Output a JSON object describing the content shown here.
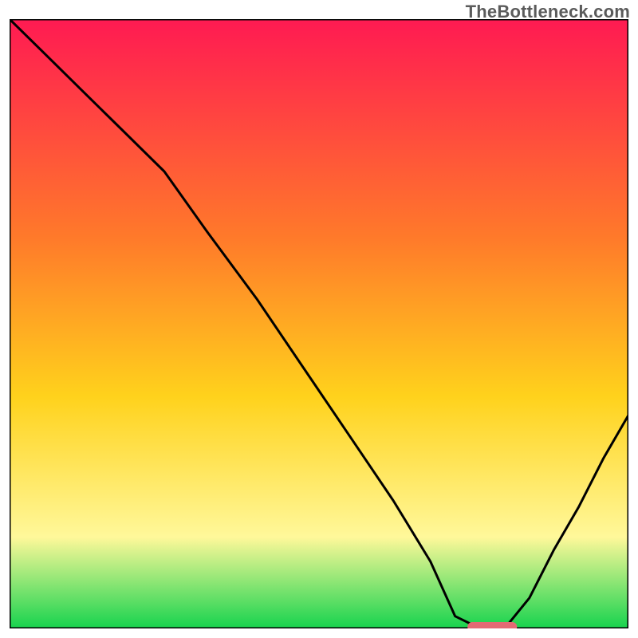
{
  "watermark": "TheBottleneck.com",
  "chart_data": {
    "type": "line",
    "title": "",
    "xlabel": "",
    "ylabel": "",
    "xlim": [
      0,
      100
    ],
    "ylim": [
      0,
      100
    ],
    "grid": false,
    "legend": false,
    "annotations": [],
    "background_gradient": {
      "top": "#ff1a52",
      "mid1": "#ff7a2a",
      "mid2": "#ffd21c",
      "mid3": "#fff89a",
      "bottom": "#17d34e"
    },
    "curve_note": "Single black V-shaped curve: starts at top-left (x≈0,y≈100), descends nearly linearly with a slope change around x≈25 y≈75, reaches a flat minimum near x≈72–80 at y≈0, then rises toward x=100 y≈35. A short red-pink rounded bar sits on the x-axis at the curve minimum.",
    "series": [
      {
        "name": "curve",
        "x": [
          0,
          6,
          12,
          18,
          25,
          32,
          40,
          48,
          56,
          62,
          68,
          72,
          76,
          80,
          84,
          88,
          92,
          96,
          100
        ],
        "y": [
          100,
          94,
          88,
          82,
          75,
          65,
          54,
          42,
          30,
          21,
          11,
          2,
          0,
          0,
          5,
          13,
          20,
          28,
          35
        ]
      }
    ],
    "min_marker": {
      "x_start": 74,
      "x_end": 82,
      "y": 0,
      "color": "#e46a74"
    }
  }
}
